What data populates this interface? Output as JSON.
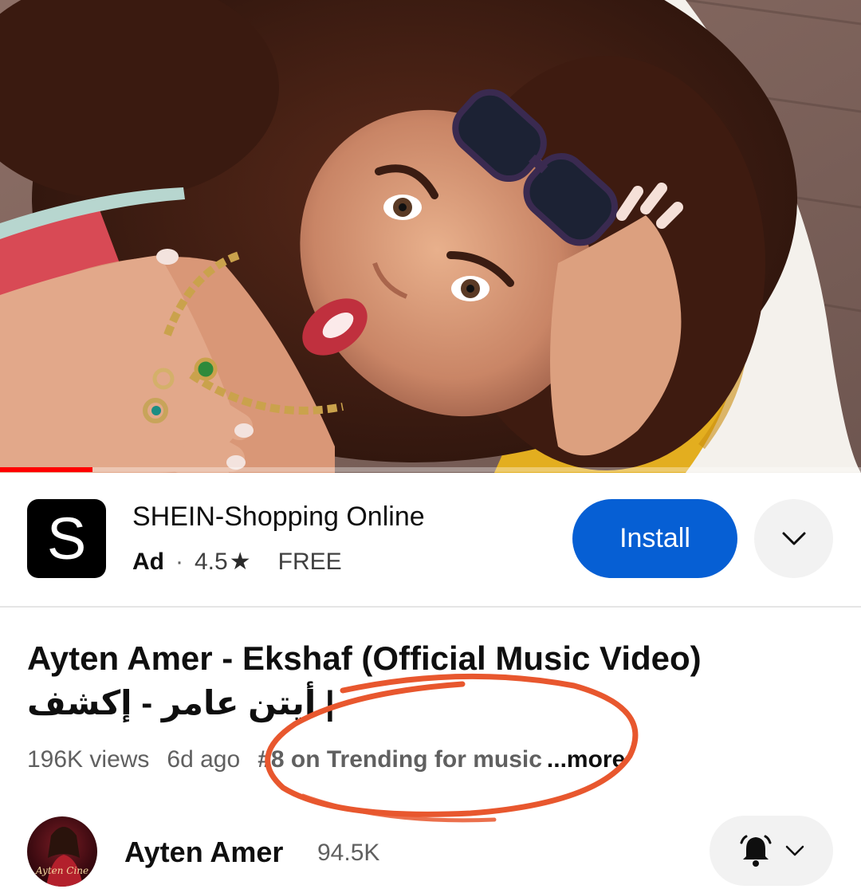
{
  "player": {
    "progress_fraction": 0.107
  },
  "ad": {
    "logo_letter": "S",
    "title": "SHEIN-Shopping Online",
    "label": "Ad",
    "separator": "·",
    "rating": "4.5",
    "star_glyph": "★",
    "price": "FREE",
    "install_label": "Install",
    "accent_color": "#065fd4"
  },
  "video": {
    "title_line1": "Ayten Amer - Ekshaf (Official Music Video)",
    "title_line2": "أيتن عامر - إكشف |",
    "views": "196K views",
    "age": "6d ago",
    "trending": "#8 on Trending for music",
    "more": "...more"
  },
  "annotation": {
    "color": "#e8572e"
  },
  "channel": {
    "name": "Ayten Amer",
    "subscribers": "94.5K",
    "avatar_text": "Ayten Cine"
  },
  "icons": [
    "chevron-down-icon",
    "bell-icon",
    "star-icon"
  ]
}
